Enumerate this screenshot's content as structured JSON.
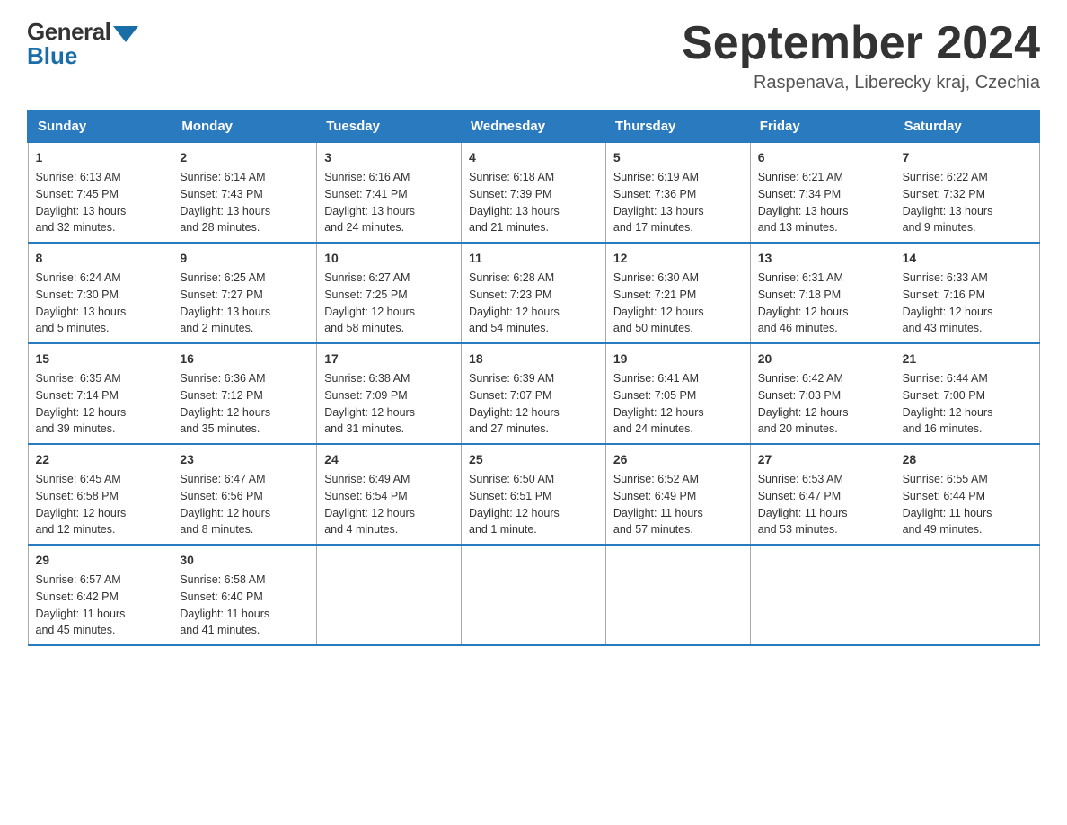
{
  "header": {
    "logo_general": "General",
    "logo_blue": "Blue",
    "month_title": "September 2024",
    "location": "Raspenava, Liberecky kraj, Czechia"
  },
  "days_of_week": [
    "Sunday",
    "Monday",
    "Tuesday",
    "Wednesday",
    "Thursday",
    "Friday",
    "Saturday"
  ],
  "weeks": [
    [
      {
        "day": "1",
        "sunrise": "6:13 AM",
        "sunset": "7:45 PM",
        "daylight": "13 hours and 32 minutes."
      },
      {
        "day": "2",
        "sunrise": "6:14 AM",
        "sunset": "7:43 PM",
        "daylight": "13 hours and 28 minutes."
      },
      {
        "day": "3",
        "sunrise": "6:16 AM",
        "sunset": "7:41 PM",
        "daylight": "13 hours and 24 minutes."
      },
      {
        "day": "4",
        "sunrise": "6:18 AM",
        "sunset": "7:39 PM",
        "daylight": "13 hours and 21 minutes."
      },
      {
        "day": "5",
        "sunrise": "6:19 AM",
        "sunset": "7:36 PM",
        "daylight": "13 hours and 17 minutes."
      },
      {
        "day": "6",
        "sunrise": "6:21 AM",
        "sunset": "7:34 PM",
        "daylight": "13 hours and 13 minutes."
      },
      {
        "day": "7",
        "sunrise": "6:22 AM",
        "sunset": "7:32 PM",
        "daylight": "13 hours and 9 minutes."
      }
    ],
    [
      {
        "day": "8",
        "sunrise": "6:24 AM",
        "sunset": "7:30 PM",
        "daylight": "13 hours and 5 minutes."
      },
      {
        "day": "9",
        "sunrise": "6:25 AM",
        "sunset": "7:27 PM",
        "daylight": "13 hours and 2 minutes."
      },
      {
        "day": "10",
        "sunrise": "6:27 AM",
        "sunset": "7:25 PM",
        "daylight": "12 hours and 58 minutes."
      },
      {
        "day": "11",
        "sunrise": "6:28 AM",
        "sunset": "7:23 PM",
        "daylight": "12 hours and 54 minutes."
      },
      {
        "day": "12",
        "sunrise": "6:30 AM",
        "sunset": "7:21 PM",
        "daylight": "12 hours and 50 minutes."
      },
      {
        "day": "13",
        "sunrise": "6:31 AM",
        "sunset": "7:18 PM",
        "daylight": "12 hours and 46 minutes."
      },
      {
        "day": "14",
        "sunrise": "6:33 AM",
        "sunset": "7:16 PM",
        "daylight": "12 hours and 43 minutes."
      }
    ],
    [
      {
        "day": "15",
        "sunrise": "6:35 AM",
        "sunset": "7:14 PM",
        "daylight": "12 hours and 39 minutes."
      },
      {
        "day": "16",
        "sunrise": "6:36 AM",
        "sunset": "7:12 PM",
        "daylight": "12 hours and 35 minutes."
      },
      {
        "day": "17",
        "sunrise": "6:38 AM",
        "sunset": "7:09 PM",
        "daylight": "12 hours and 31 minutes."
      },
      {
        "day": "18",
        "sunrise": "6:39 AM",
        "sunset": "7:07 PM",
        "daylight": "12 hours and 27 minutes."
      },
      {
        "day": "19",
        "sunrise": "6:41 AM",
        "sunset": "7:05 PM",
        "daylight": "12 hours and 24 minutes."
      },
      {
        "day": "20",
        "sunrise": "6:42 AM",
        "sunset": "7:03 PM",
        "daylight": "12 hours and 20 minutes."
      },
      {
        "day": "21",
        "sunrise": "6:44 AM",
        "sunset": "7:00 PM",
        "daylight": "12 hours and 16 minutes."
      }
    ],
    [
      {
        "day": "22",
        "sunrise": "6:45 AM",
        "sunset": "6:58 PM",
        "daylight": "12 hours and 12 minutes."
      },
      {
        "day": "23",
        "sunrise": "6:47 AM",
        "sunset": "6:56 PM",
        "daylight": "12 hours and 8 minutes."
      },
      {
        "day": "24",
        "sunrise": "6:49 AM",
        "sunset": "6:54 PM",
        "daylight": "12 hours and 4 minutes."
      },
      {
        "day": "25",
        "sunrise": "6:50 AM",
        "sunset": "6:51 PM",
        "daylight": "12 hours and 1 minute."
      },
      {
        "day": "26",
        "sunrise": "6:52 AM",
        "sunset": "6:49 PM",
        "daylight": "11 hours and 57 minutes."
      },
      {
        "day": "27",
        "sunrise": "6:53 AM",
        "sunset": "6:47 PM",
        "daylight": "11 hours and 53 minutes."
      },
      {
        "day": "28",
        "sunrise": "6:55 AM",
        "sunset": "6:44 PM",
        "daylight": "11 hours and 49 minutes."
      }
    ],
    [
      {
        "day": "29",
        "sunrise": "6:57 AM",
        "sunset": "6:42 PM",
        "daylight": "11 hours and 45 minutes."
      },
      {
        "day": "30",
        "sunrise": "6:58 AM",
        "sunset": "6:40 PM",
        "daylight": "11 hours and 41 minutes."
      },
      null,
      null,
      null,
      null,
      null
    ]
  ],
  "labels": {
    "sunrise": "Sunrise:",
    "sunset": "Sunset:",
    "daylight": "Daylight:"
  }
}
